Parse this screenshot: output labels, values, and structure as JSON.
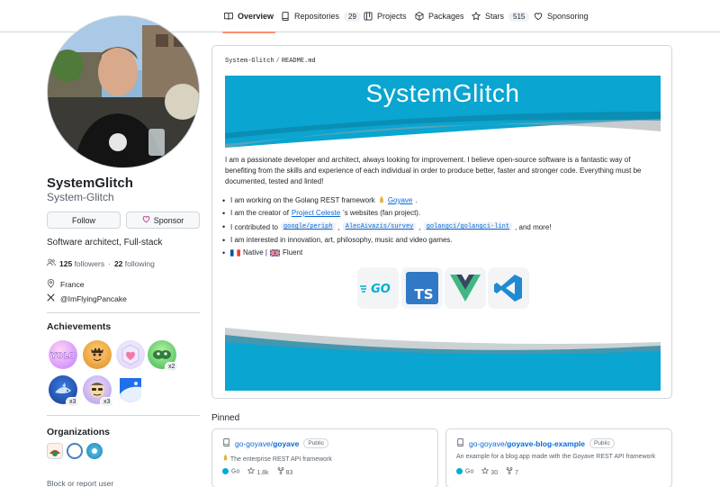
{
  "nav": {
    "tabs": [
      {
        "label": "Overview",
        "icon": "book-icon",
        "count": ""
      },
      {
        "label": "Repositories",
        "icon": "repo-icon",
        "count": "29"
      },
      {
        "label": "Projects",
        "icon": "project-icon",
        "count": ""
      },
      {
        "label": "Packages",
        "icon": "package-icon",
        "count": ""
      },
      {
        "label": "Stars",
        "icon": "star-icon",
        "count": "515"
      },
      {
        "label": "Sponsoring",
        "icon": "heart-icon",
        "count": ""
      }
    ]
  },
  "profile": {
    "name": "SystemGlitch",
    "login": "System-Glitch",
    "follow_label": "Follow",
    "sponsor_label": "Sponsor",
    "bio": "Software architect, Full-stack",
    "followers_count": "125",
    "followers_label": "followers",
    "following_count": "22",
    "following_label": "following",
    "location": "France",
    "social": "@ImFlyingPancake"
  },
  "achievements": {
    "title": "Achievements",
    "badges": [
      {
        "name": "yolo",
        "count": ""
      },
      {
        "name": "starstruck",
        "count": ""
      },
      {
        "name": "heart-on-sleeve",
        "count": ""
      },
      {
        "name": "pair-extraordinaire",
        "count": "x2"
      },
      {
        "name": "pull-shark",
        "count": "x3"
      },
      {
        "name": "galaxy-brain",
        "count": "x3"
      },
      {
        "name": "arctic-code-vault",
        "count": ""
      }
    ]
  },
  "organizations": {
    "title": "Organizations"
  },
  "block_label": "Block or report user",
  "readme": {
    "crumb_user": "System-Glitch",
    "crumb_sep": "/",
    "crumb_file": "README.md",
    "banner_title": "SystemGlitch",
    "intro": "I am a passionate developer and architect, always looking for improvement. I believe open-source software is a fantastic way of benefiting from the skills and experience of each individual in order to produce better, faster and stronger code. Everything must be documented, tested and linted!",
    "item1_text": "I am working on the Golang REST framework",
    "item1_link": "Goyave",
    "item1_end": ".",
    "item2_text": "I am the creator of",
    "item2_link": "Project Celeste",
    "item2_end": "'s websites (fan project).",
    "item3_text": "I contributed to",
    "item3_code1": "google/periph",
    "item3_code2": "AlecAivazis/survey",
    "item3_code3": "golangci/golangci-lint",
    "item3_end": ", and more!",
    "item4_text": "I am interested in innovation, art, philosophy, music and video games.",
    "item5_native": "Native |",
    "item5_fluent": "Fluent",
    "tech_logos": [
      "go-logo",
      "typescript-logo",
      "vue-logo",
      "vscode-logo"
    ],
    "tech_go": "GO",
    "tech_ts": "TS"
  },
  "pinned": {
    "title": "Pinned",
    "repos": [
      {
        "owner": "go-goyave/",
        "name": "goyave",
        "visibility": "Public",
        "description": "The enterprise REST API framework",
        "language": "Go",
        "stars": "1.8k",
        "forks": "83"
      },
      {
        "owner": "go-goyave/",
        "name": "goyave-blog-example",
        "visibility": "Public",
        "description": "An example for a blog app made with the Goyave REST API framework",
        "language": "Go",
        "stars": "30",
        "forks": "7"
      }
    ]
  },
  "colors": {
    "accent": "#fd8c73",
    "link": "#0969da",
    "banner": "#0aa5d0",
    "go": "#00add8"
  }
}
